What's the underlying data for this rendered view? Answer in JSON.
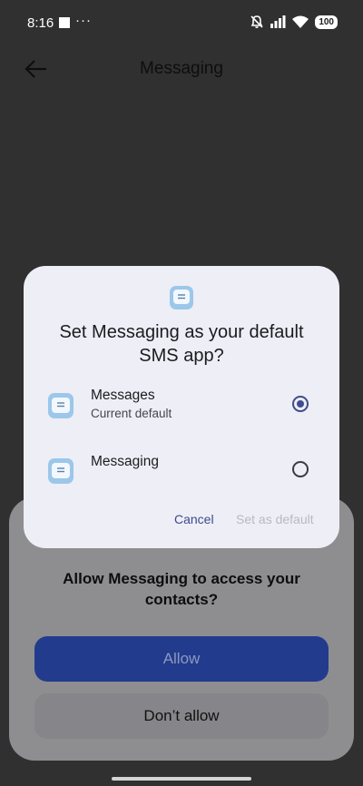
{
  "status_bar": {
    "time": "8:16",
    "overflow": "···",
    "battery": "100",
    "icons": [
      "notification-square-icon",
      "bell-off-icon",
      "signal-icon",
      "wifi-icon",
      "battery-icon"
    ]
  },
  "app_bar": {
    "title": "Messaging",
    "back_icon": "arrow-left-icon"
  },
  "permission_sheet": {
    "title": "Allow Messaging to access your contacts?",
    "allow_label": "Allow",
    "deny_label": "Don’t allow"
  },
  "dialog": {
    "title": "Set Messaging as your default SMS app?",
    "options": [
      {
        "name": "Messages",
        "subtitle": "Current default",
        "selected": true,
        "icon": "chat-bubble-icon"
      },
      {
        "name": "Messaging",
        "subtitle": "",
        "selected": false,
        "icon": "chat-bubble-icon"
      }
    ],
    "cancel_label": "Cancel",
    "confirm_label": "Set as default"
  },
  "colors": {
    "scrim": "#303030",
    "dialog_bg": "#eeeef6",
    "accent": "#3f4d8c",
    "allow_button": "#223b8c"
  }
}
